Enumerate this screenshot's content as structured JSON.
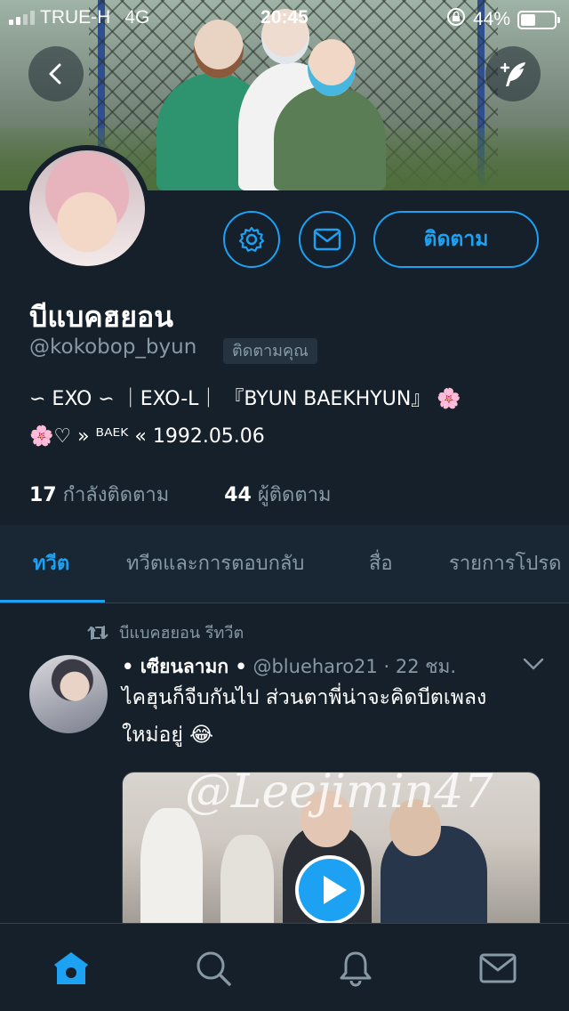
{
  "status_bar": {
    "carrier": "TRUE-H",
    "network": "4G",
    "time": "20:45",
    "battery": "44%"
  },
  "profile": {
    "display_name": "บีแบคฮยอน",
    "handle": "@kokobop_byun",
    "follows_you_badge": "ติดตามคุณ",
    "bio_line1": "∽ EXO ∽ ｜EXO-L｜ 『BYUN BAEKHYUN』 🌸",
    "bio_line2": "🌸♡ » ᴮᴬᴱᴷ « 1992.05.06",
    "following_count": "17",
    "following_label": "กำลังติดตาม",
    "followers_count": "44",
    "followers_label": "ผู้ติดตาม",
    "follow_button": "ติดตาม"
  },
  "tabs": [
    {
      "label": "ทวีต",
      "active": true
    },
    {
      "label": "ทวีตและการตอบกลับ",
      "active": false
    },
    {
      "label": "สื่อ",
      "active": false
    },
    {
      "label": "รายการโปรด",
      "active": false
    }
  ],
  "tweet": {
    "retweet_label": "บีแบคฮยอน รีทวีต",
    "author_name": "• เซียนลามก •",
    "author_handle": "@blueharo21",
    "time": "· 22 ชม.",
    "text_line1": "ไคฮุนก็จีบกันไป ส่วนตาพี่น่าจะคิดบีตเพลง",
    "text_line2": "ใหม่อยู่ 😂",
    "media_watermark": "@Leejimin47"
  },
  "icons": {
    "back": "back-arrow-icon",
    "compose": "compose-tweet-icon",
    "settings": "gear-icon",
    "message": "envelope-icon",
    "retweet": "retweet-icon",
    "home": "home-icon",
    "search": "search-icon",
    "notifications": "bell-icon",
    "messages": "mail-icon"
  },
  "colors": {
    "background": "#15202b",
    "accent": "#1da1f2",
    "secondary_text": "#8899a6"
  }
}
